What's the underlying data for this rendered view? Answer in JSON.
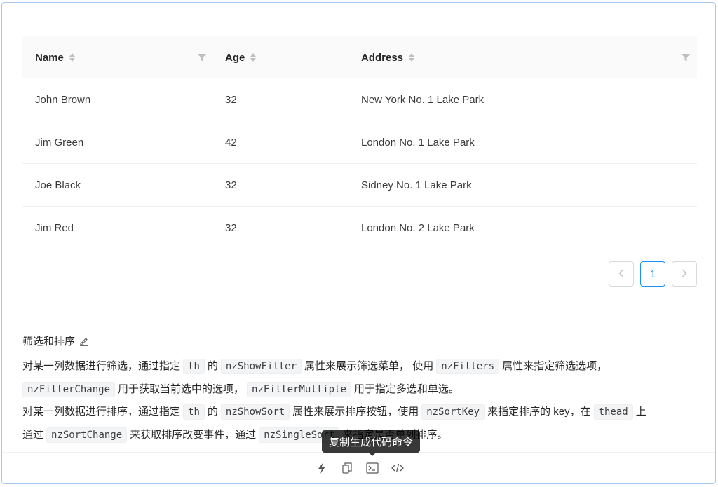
{
  "table": {
    "columns": [
      {
        "label": "Name",
        "sortable": true,
        "filterable": true
      },
      {
        "label": "Age",
        "sortable": true,
        "filterable": false
      },
      {
        "label": "Address",
        "sortable": true,
        "filterable": true
      }
    ],
    "rows": [
      {
        "name": "John Brown",
        "age": "32",
        "address": "New York No. 1 Lake Park"
      },
      {
        "name": "Jim Green",
        "age": "42",
        "address": "London No. 1 Lake Park"
      },
      {
        "name": "Joe Black",
        "age": "32",
        "address": "Sidney No. 1 Lake Park"
      },
      {
        "name": "Jim Red",
        "age": "32",
        "address": "London No. 2 Lake Park"
      }
    ]
  },
  "pagination": {
    "prev_icon": "left-icon",
    "current_page": "1",
    "next_icon": "right-icon"
  },
  "section": {
    "title": "筛选和排序",
    "edit_icon": "edit-icon"
  },
  "description": {
    "p1_a": "对某一列数据进行筛选，通过指定",
    "p1_code1": "th",
    "p1_b": "的",
    "p1_code2": "nzShowFilter",
    "p1_c": "属性来展示筛选菜单， 使用",
    "p1_code3": "nzFilters",
    "p1_d": "属性来指定筛选选项，",
    "p1_code4": "nzFilterChange",
    "p1_e": "用于获取当前选中的选项，",
    "p1_code5": "nzFilterMultiple",
    "p1_f": "用于指定多选和单选。",
    "p2_a": "对某一列数据进行排序，通过指定",
    "p2_code1": "th",
    "p2_b": "的",
    "p2_code2": "nzShowSort",
    "p2_c": "属性来展示排序按钮，使用",
    "p2_code3": "nzSortKey",
    "p2_d": "来指定排序的 key，在",
    "p2_code4": "thead",
    "p2_e": "上",
    "p2_f": "通过",
    "p2_code5": "nzSortChange",
    "p2_g": "来获取排序改变事件，通过",
    "p2_code6": "nzSingleSort",
    "p2_h": "来指定是否单列排序。"
  },
  "tooltip": {
    "text": "复制生成代码命令"
  },
  "actions": [
    {
      "name": "thunderbolt-icon"
    },
    {
      "name": "copy-icon"
    },
    {
      "name": "terminal-icon"
    },
    {
      "name": "code-icon"
    }
  ],
  "colors": {
    "accent": "#1890ff",
    "frame_border": "#a9c8ef",
    "header_bg": "#fafafa"
  }
}
